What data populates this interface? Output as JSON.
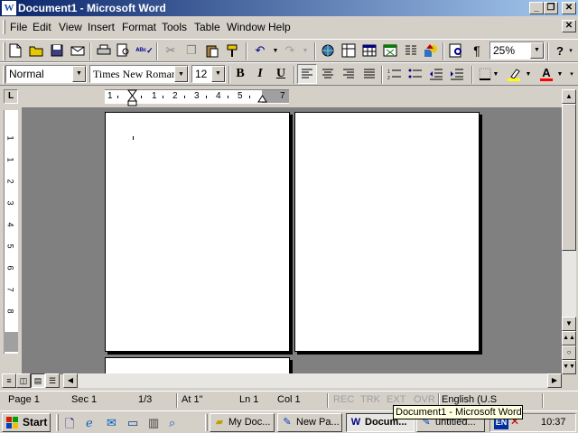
{
  "window": {
    "title": "Document1 - Microsoft Word",
    "app_icon": "W",
    "controls": {
      "minimize": "_",
      "restore": "❐",
      "close": "✕"
    },
    "doc_close": "✕"
  },
  "menu": [
    "File",
    "Edit",
    "View",
    "Insert",
    "Format",
    "Tools",
    "Table",
    "Window",
    "Help"
  ],
  "standard_toolbar": {
    "zoom": "25%",
    "help": "?"
  },
  "formatting_toolbar": {
    "style": "Normal",
    "font": "Times New Roman",
    "size": "12",
    "bold": "B",
    "italic": "I",
    "underline": "U",
    "font_color_letter": "A",
    "highlight_color": "#ffff00",
    "font_color": "#ff0000"
  },
  "ruler": {
    "tab_marker": "L",
    "h_numbers": [
      "1",
      "1",
      "2",
      "3",
      "4",
      "5",
      "7"
    ],
    "v_numbers": [
      "1",
      "1",
      "2",
      "3",
      "4",
      "5",
      "6",
      "7",
      "8"
    ]
  },
  "statusbar": {
    "page": "Page 1",
    "sec": "Sec 1",
    "pages": "1/3",
    "at": "At 1\"",
    "ln": "Ln 1",
    "col": "Col 1",
    "rec": "REC",
    "trk": "TRK",
    "ext": "EXT",
    "ovr": "OVR",
    "language": "English (U.S"
  },
  "taskbar": {
    "start": "Start",
    "tasks": [
      {
        "label": "My Doc...",
        "icon": "folder-icon"
      },
      {
        "label": "New Pa...",
        "icon": "paint-icon"
      },
      {
        "label": "Docum...",
        "icon": "word-icon",
        "active": true
      },
      {
        "label": "untitled...",
        "icon": "paint-icon"
      }
    ],
    "tray_lang": "EN",
    "clock": "10:37"
  },
  "tooltip": "Document1 - Microsoft Word"
}
